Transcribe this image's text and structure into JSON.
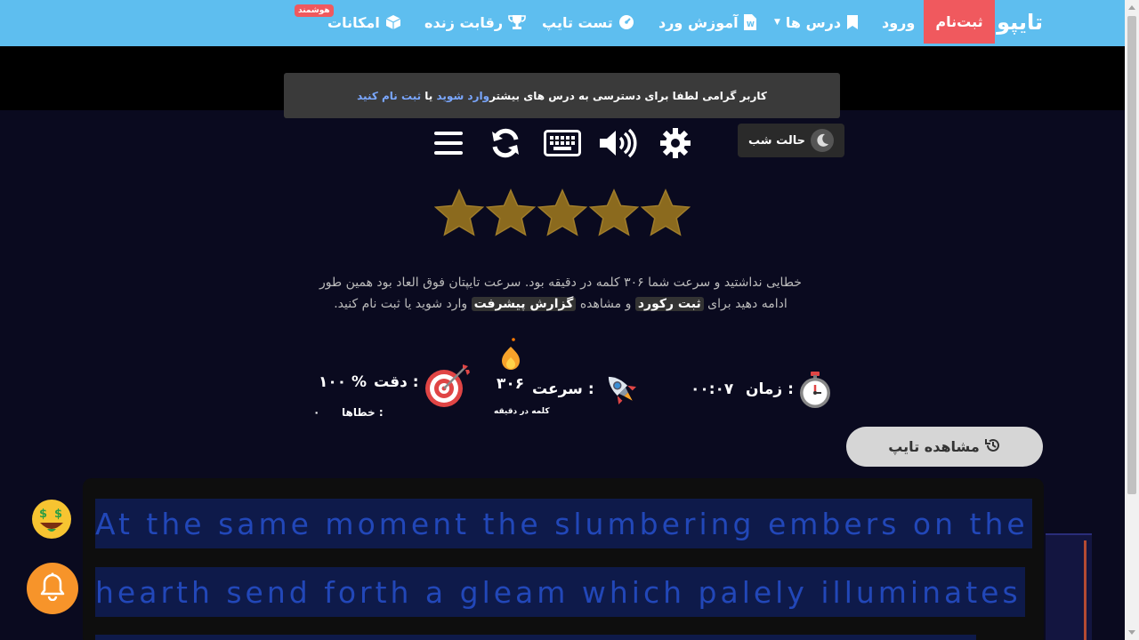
{
  "nav": {
    "brand": "تایپو",
    "signup": "ثبت‌نام",
    "login": "ورود",
    "lessons": "درس ها",
    "word_training": "آموزش ورد",
    "typing_test": "تست تایپ",
    "live_competition": "رقابت زنده",
    "features": "امکانات",
    "smart_badge": "هوشمند"
  },
  "notice": {
    "text_before": "کاربر گرامی لطفا برای دسترسی به درس های بیشتر ",
    "login_link": "وارد شوید",
    "middle": " یا ",
    "signup_link": "ثبت نام کنید"
  },
  "night_mode": {
    "label": "حالت شب"
  },
  "toolbar": [
    "menu-icon",
    "refresh-icon",
    "keyboard-icon",
    "volume-icon",
    "gear-icon"
  ],
  "rating": {
    "stars": 5,
    "max": 5,
    "star_color": "#8b6a1e"
  },
  "result": {
    "line1": "خطایی نداشتید و سرعت شما ۳۰۶ کلمه در دقیقه بود. سرعت تایپتان فوق العاد بود همین طور",
    "line2_a": "ادامه دهید برای ",
    "record": "ثبت رکورد",
    "line2_b": " و مشاهده ",
    "advanced_report": "گزارش پیشرفت",
    "line2_c": " وارد شوید یا ثبت نام کنید."
  },
  "stats": {
    "time_label": "زمان :",
    "time_value": "۰۰:۰۷",
    "speed_label": "سرعت :",
    "speed_value": "۳۰۶",
    "speed_unit": "کلمه در دقیقه",
    "accuracy_label": "دقت :",
    "accuracy_value": "۱۰۰ %",
    "errors_label": "خطاها :",
    "errors_value": "۰"
  },
  "watch_typing": {
    "label": "مشاهده تایپ"
  },
  "typing_text": {
    "line1": "At the same moment the slumbering embers on the",
    "line2": "hearth send forth a gleam which palely illuminates"
  },
  "colors": {
    "navbar": "#5ebeef",
    "signup": "#f0595e",
    "text_highlight": "#0e1a4a",
    "text_color": "#2247b8",
    "bell": "#f7942a"
  }
}
